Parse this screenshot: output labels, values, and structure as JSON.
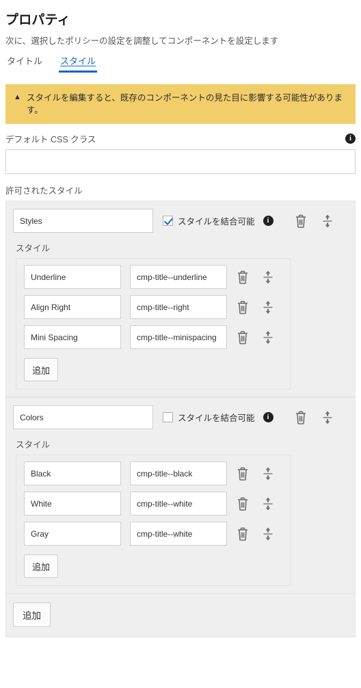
{
  "header": {
    "title": "プロパティ",
    "subtitle": "次に、選択したポリシーの設定を調整してコンポーネントを設定します"
  },
  "tabs": [
    {
      "label": "タイトル",
      "active": false
    },
    {
      "label": "スタイル",
      "active": true
    }
  ],
  "warning": {
    "icon": "warning-triangle-icon",
    "text": "スタイルを編集すると、既存のコンポーネントの見た目に影響する可能性があります。"
  },
  "default_css_class": {
    "label": "デフォルト CSS クラス",
    "value": "",
    "placeholder": "",
    "info_icon": "info-icon"
  },
  "allowed_styles": {
    "label": "許可されたスタイル",
    "styles_sublabel": "スタイル",
    "merge_label": "スタイルを結合可能",
    "add_label": "追加",
    "outer_add_label": "追加",
    "groups": [
      {
        "name": "Styles",
        "merge_checked": true,
        "rows": [
          {
            "name": "Underline",
            "class": "cmp-title--underline"
          },
          {
            "name": "Align Right",
            "class": "cmp-title--right"
          },
          {
            "name": "Mini Spacing",
            "class": "cmp-title--minispacing"
          }
        ]
      },
      {
        "name": "Colors",
        "merge_checked": false,
        "rows": [
          {
            "name": "Black",
            "class": "cmp-title--black"
          },
          {
            "name": "White",
            "class": "cmp-title--white"
          },
          {
            "name": "Gray",
            "class": "cmp-title--white"
          }
        ]
      }
    ]
  },
  "colors": {
    "accent": "#1565c0",
    "warning_bg": "#f2ce6b",
    "panel_bg": "#efefef",
    "icon_gray": "#6e6e6e"
  }
}
